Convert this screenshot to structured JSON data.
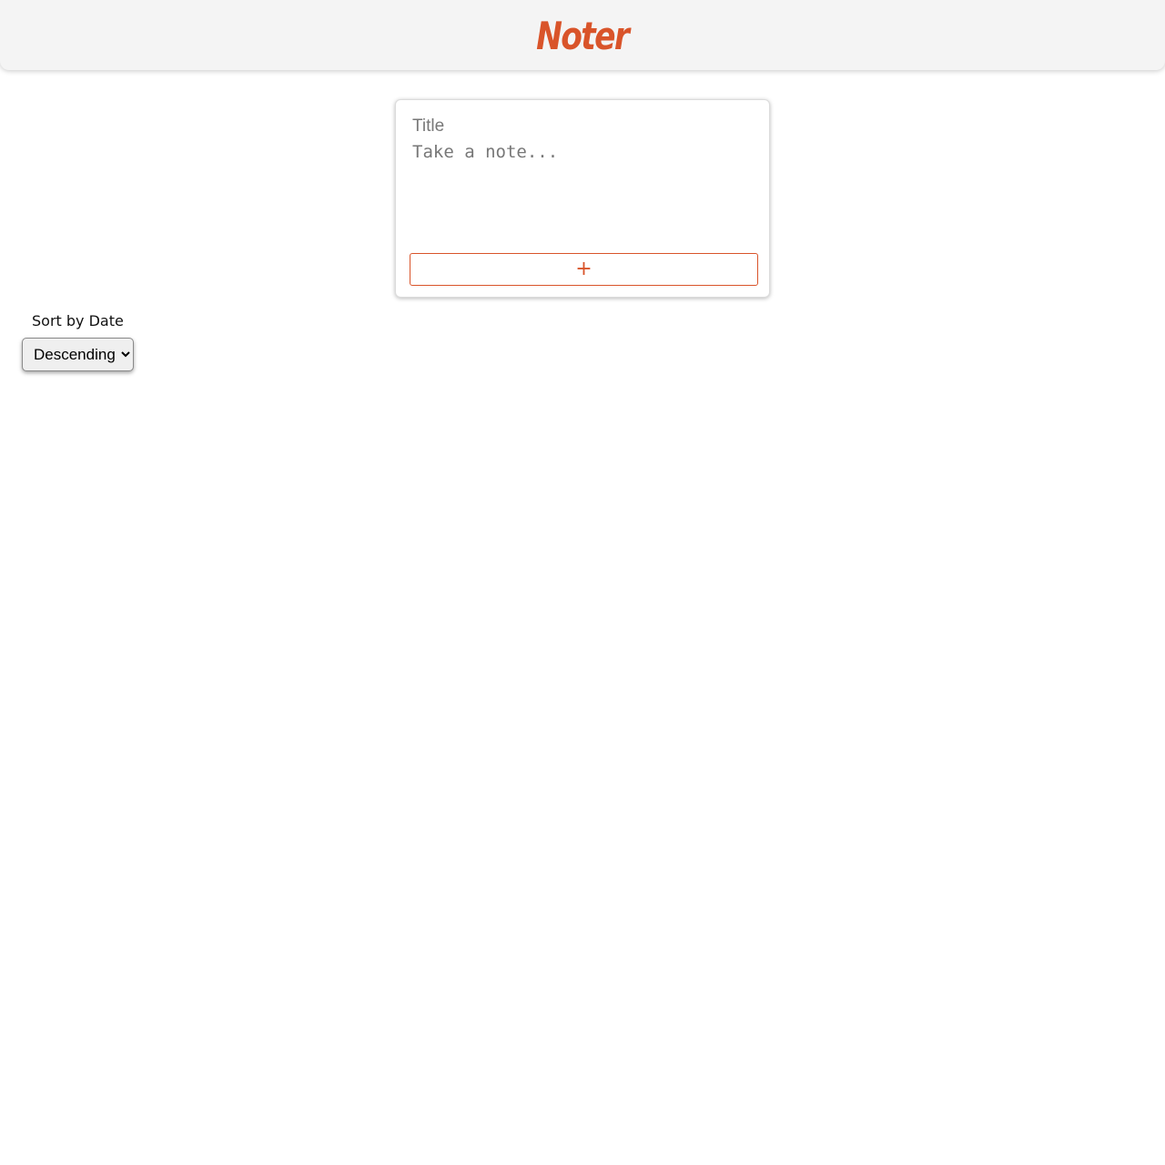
{
  "header": {
    "logo_text": "Noter",
    "accent_color": "#d9542a"
  },
  "note_form": {
    "title_placeholder": "Title",
    "title_value": "",
    "body_placeholder": "Take a note...",
    "body_value": "",
    "add_button_label": "+"
  },
  "sort": {
    "label": "Sort by Date",
    "selected": "Descending",
    "options": [
      "Descending"
    ]
  }
}
